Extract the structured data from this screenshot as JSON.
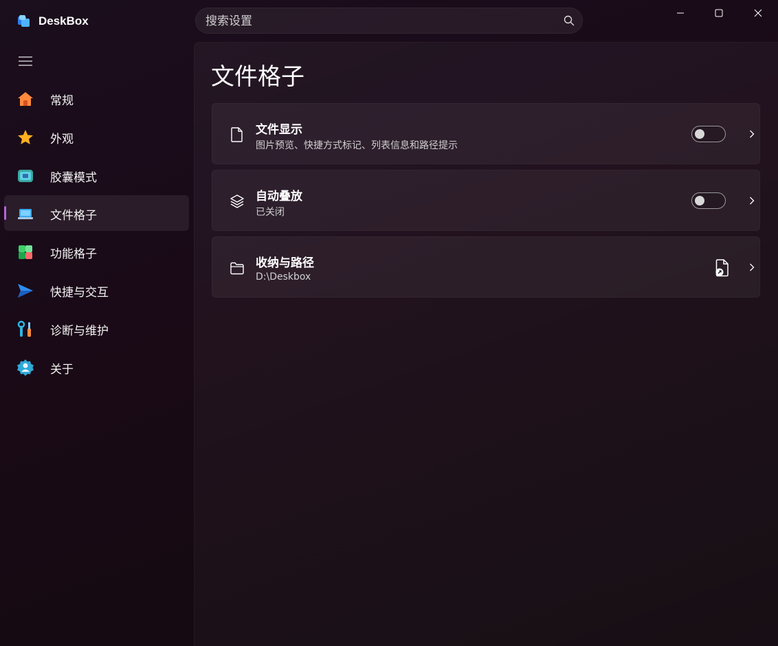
{
  "app": {
    "title": "DeskBox"
  },
  "search": {
    "placeholder": "搜索设置",
    "icon": "search-icon"
  },
  "window_controls": [
    "minimize",
    "maximize",
    "close"
  ],
  "sidebar": {
    "menu_icon": "hamburger-icon",
    "items": [
      {
        "label": "常规",
        "icon": "home-icon",
        "selected": false
      },
      {
        "label": "外观",
        "icon": "star-icon",
        "selected": false
      },
      {
        "label": "胶囊模式",
        "icon": "capsule-icon",
        "selected": false
      },
      {
        "label": "文件格子",
        "icon": "laptop-icon",
        "selected": true
      },
      {
        "label": "功能格子",
        "icon": "grid-icon",
        "selected": false
      },
      {
        "label": "快捷与交互",
        "icon": "send-icon",
        "selected": false
      },
      {
        "label": "诊断与维护",
        "icon": "tools-icon",
        "selected": false
      },
      {
        "label": "关于",
        "icon": "about-icon",
        "selected": false
      }
    ]
  },
  "page": {
    "title": "文件格子",
    "cards": [
      {
        "title": "文件显示",
        "subtitle": "图片预览、快捷方式标记、列表信息和路径提示",
        "icon": "file-icon",
        "control": "toggle",
        "toggle_on": false
      },
      {
        "title": "自动叠放",
        "subtitle": "已关闭",
        "icon": "layers-icon",
        "control": "toggle",
        "toggle_on": false
      },
      {
        "title": "收纳与路径",
        "subtitle": "D:\\Deskbox",
        "icon": "folder-icon",
        "control": "open-file-button"
      }
    ]
  },
  "colors": {
    "accent": "#b764d6"
  }
}
